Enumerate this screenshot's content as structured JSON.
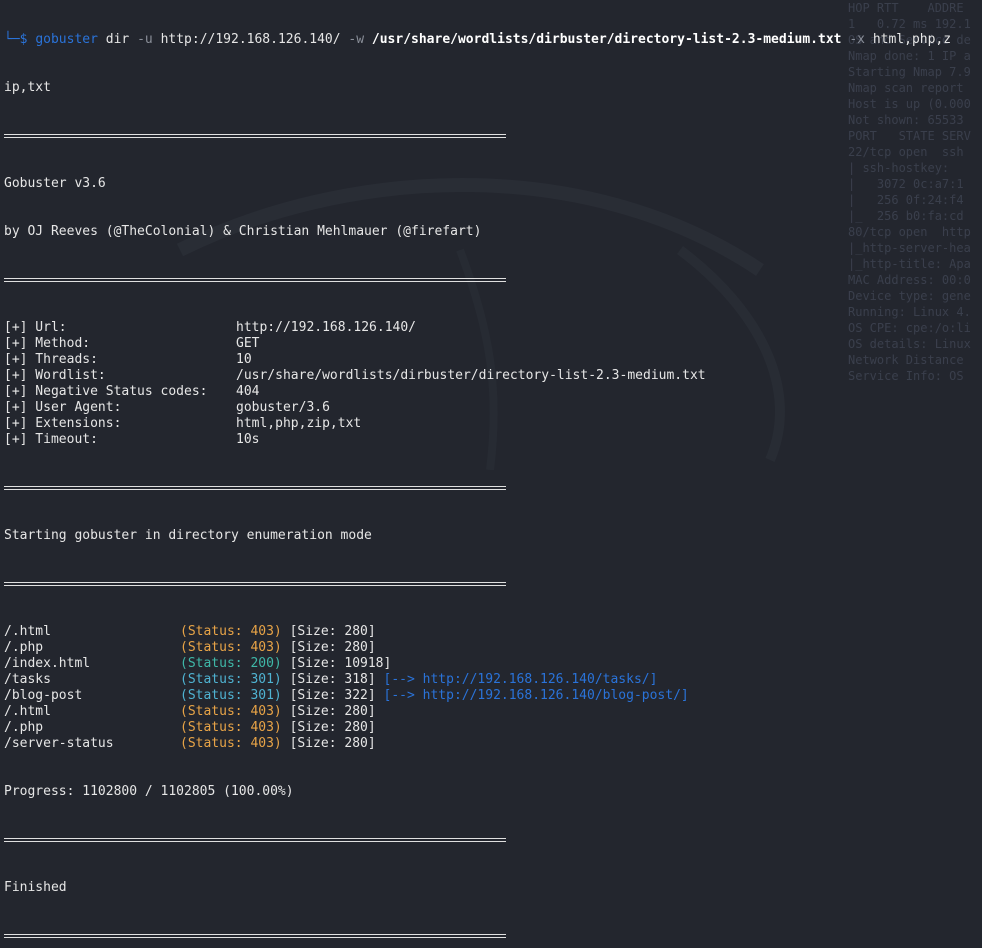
{
  "prompt": {
    "corner": "└─",
    "symbol": "$",
    "command": "gobuster",
    "args": [
      {
        "text": "dir",
        "style": "plain"
      },
      {
        "text": "-u",
        "style": "opt"
      },
      {
        "text": "http://192.168.126.140/",
        "style": "plain"
      },
      {
        "text": "-w",
        "style": "opt"
      },
      {
        "text": "/usr/share/wordlists/dirbuster/directory-list-2.3-medium.txt",
        "style": "bold"
      },
      {
        "text": "-x",
        "style": "opt"
      },
      {
        "text": "html,php,z",
        "style": "plain"
      }
    ],
    "wrap": "ip,txt"
  },
  "banner": {
    "title": "Gobuster v3.6",
    "authors": "by OJ Reeves (@TheColonial) & Christian Mehlmauer (@firefart)"
  },
  "config": [
    {
      "label": "[+] Url:",
      "value": "http://192.168.126.140/"
    },
    {
      "label": "[+] Method:",
      "value": "GET"
    },
    {
      "label": "[+] Threads:",
      "value": "10"
    },
    {
      "label": "[+] Wordlist:",
      "value": "/usr/share/wordlists/dirbuster/directory-list-2.3-medium.txt"
    },
    {
      "label": "[+] Negative Status codes:",
      "value": "404"
    },
    {
      "label": "[+] User Agent:",
      "value": "gobuster/3.6"
    },
    {
      "label": "[+] Extensions:",
      "value": "html,php,zip,txt"
    },
    {
      "label": "[+] Timeout:",
      "value": "10s"
    }
  ],
  "mode_text": "Starting gobuster in directory enumeration mode",
  "results": [
    {
      "path": "/.html",
      "status": "(Status: 403)",
      "code": 403,
      "size": "[Size: 280]",
      "redirect": ""
    },
    {
      "path": "/.php",
      "status": "(Status: 403)",
      "code": 403,
      "size": "[Size: 280]",
      "redirect": ""
    },
    {
      "path": "/index.html",
      "status": "(Status: 200)",
      "code": 200,
      "size": "[Size: 10918]",
      "redirect": ""
    },
    {
      "path": "/tasks",
      "status": "(Status: 301)",
      "code": 301,
      "size": "[Size: 318]",
      "redirect": "[--> http://192.168.126.140/tasks/]"
    },
    {
      "path": "/blog-post",
      "status": "(Status: 301)",
      "code": 301,
      "size": "[Size: 322]",
      "redirect": "[--> http://192.168.126.140/blog-post/]"
    },
    {
      "path": "/.html",
      "status": "(Status: 403)",
      "code": 403,
      "size": "[Size: 280]",
      "redirect": ""
    },
    {
      "path": "/.php",
      "status": "(Status: 403)",
      "code": 403,
      "size": "[Size: 280]",
      "redirect": ""
    },
    {
      "path": "/server-status",
      "status": "(Status: 403)",
      "code": 403,
      "size": "[Size: 280]",
      "redirect": ""
    }
  ],
  "progress": "Progress: 1102800 / 1102805 (100.00%)",
  "finished": "Finished",
  "colors": {
    "background": "#23262e",
    "prompt": "#2a73d9",
    "status_403": "#e8a447",
    "status_200": "#3fb8a8",
    "status_301": "#4fb3d2",
    "redirect": "#2a73d9"
  },
  "background_pane": [
    "HOP RTT    ADDRE",
    "1   0.72 ms 192.1",
    "",
    "OS and Service de",
    "Nmap done: 1 IP a",
    "",
    "",
    "",
    "Starting Nmap 7.9",
    "Nmap scan report",
    "Host is up (0.000",
    "Not shown: 65533",
    "PORT   STATE SERV",
    "22/tcp open  ssh",
    "| ssh-hostkey:",
    "|   3072 0c:a7:1",
    "|   256 0f:24:f4",
    "|_  256 b0:fa:cd",
    "80/tcp open  http",
    "|_http-server-hea",
    "|_http-title: Apa",
    "MAC Address: 00:0",
    "Device type: gene",
    "Running: Linux 4.",
    "OS CPE: cpe:/o:li",
    "OS details: Linux",
    "Network Distance",
    "Service Info: OS"
  ]
}
